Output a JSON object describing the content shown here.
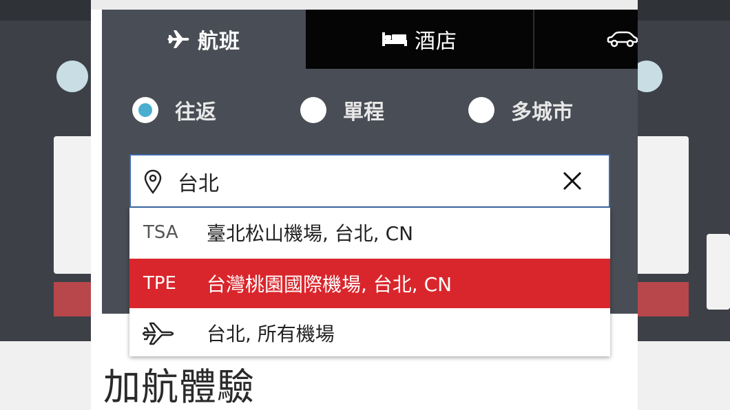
{
  "tabs": {
    "flights": "航班",
    "hotels": "酒店"
  },
  "trip_type": {
    "options": [
      "往返",
      "單程",
      "多城市"
    ],
    "selected": "往返"
  },
  "search": {
    "value": "台北"
  },
  "suggestions": [
    {
      "code": "TSA",
      "label": "臺北松山機場, 台北, CN",
      "highlighted": false
    },
    {
      "code": "TPE",
      "label": "台灣桃園國際機場, 台北, CN",
      "highlighted": true
    },
    {
      "code": "",
      "icon": "airplane-icon",
      "label": "台北, 所有機場",
      "highlighted": false
    }
  ],
  "page": {
    "heading": "加航體驗"
  },
  "colors": {
    "panel": "#494d55",
    "tab_inactive": "#050505",
    "radio_selected": "#4aaed0",
    "highlight": "#d9262c",
    "input_border": "#3e6aa8"
  },
  "icons": [
    "airplane-icon",
    "bed-icon",
    "car-icon",
    "location-pin-icon",
    "close-icon"
  ]
}
